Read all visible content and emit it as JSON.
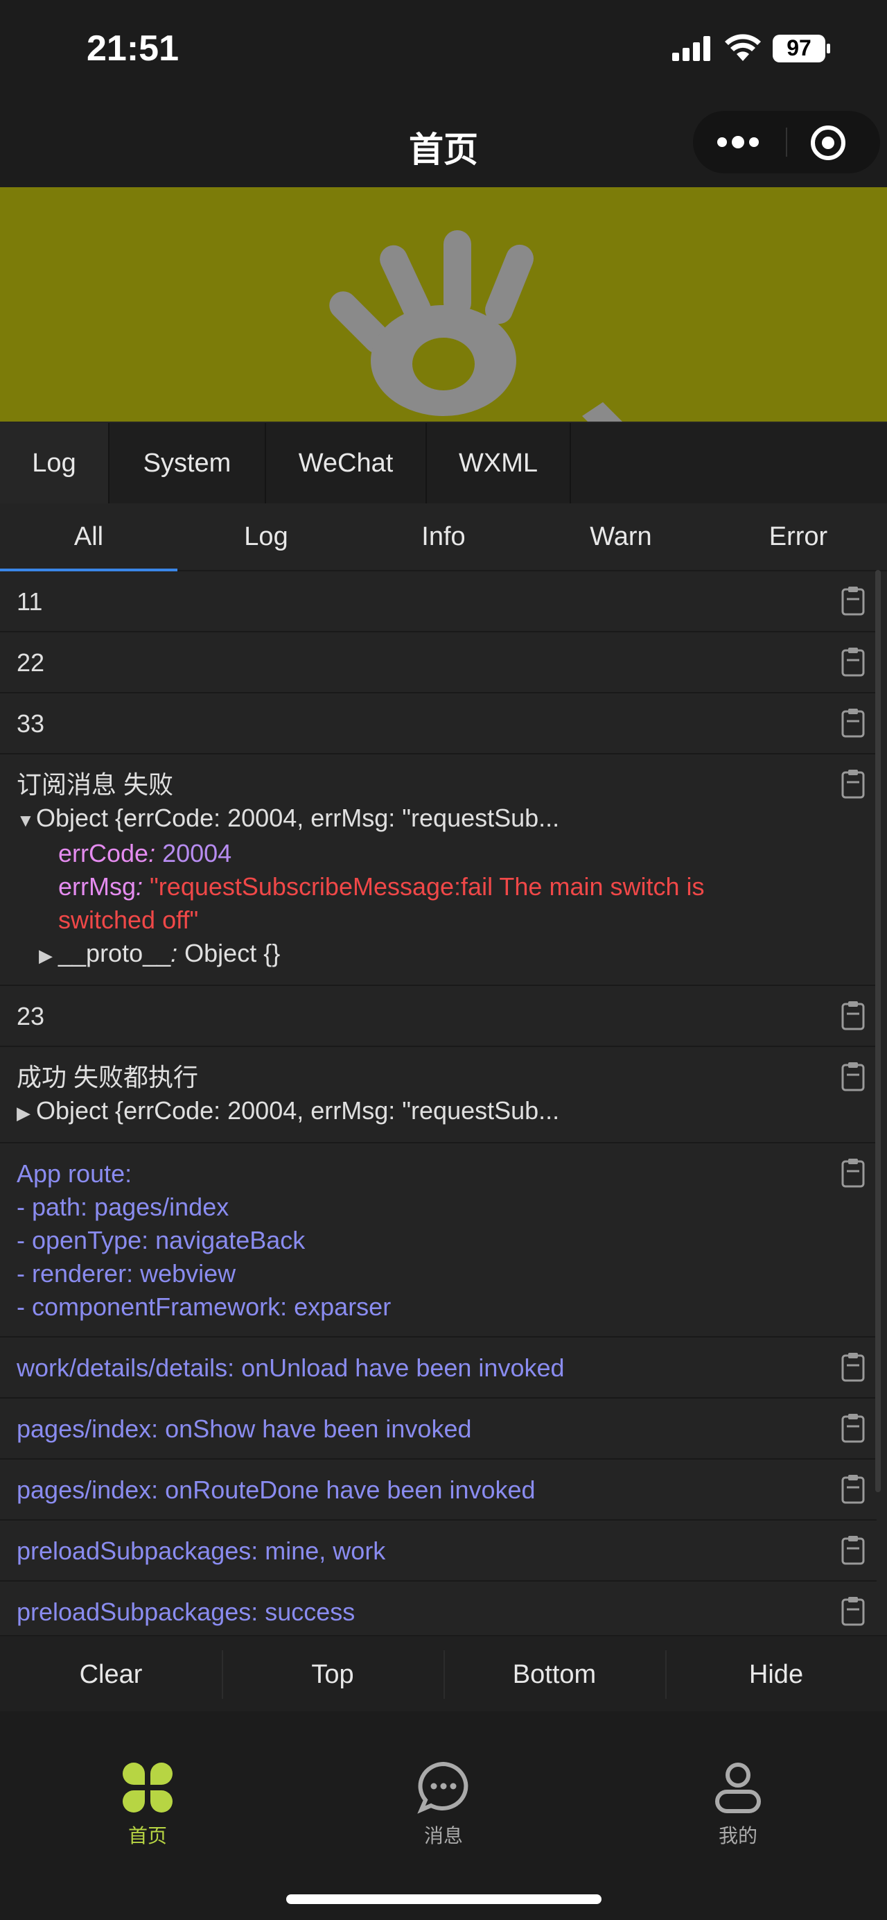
{
  "status_bar": {
    "time": "21:51",
    "battery": "97"
  },
  "nav": {
    "title": "首页"
  },
  "colors": {
    "banner": "#7c7c09",
    "accent_tab": "#3a86e8",
    "system_log": "#8a8cf0",
    "tabbar_active": "#b7d543"
  },
  "console": {
    "panel_tabs": [
      {
        "label": "Log",
        "active": true
      },
      {
        "label": "System",
        "active": false
      },
      {
        "label": "WeChat",
        "active": false
      },
      {
        "label": "WXML",
        "active": false
      }
    ],
    "filter_tabs": [
      {
        "label": "All",
        "active": true
      },
      {
        "label": "Log",
        "active": false
      },
      {
        "label": "Info",
        "active": false
      },
      {
        "label": "Warn",
        "active": false
      },
      {
        "label": "Error",
        "active": false
      }
    ],
    "entries": {
      "e1": "11",
      "e2": "22",
      "e3": "33",
      "e4": {
        "title": "订阅消息 失败",
        "summary": "Object {errCode: 20004, errMsg: \"requestSub...",
        "errCode_key": "errCode",
        "errCode_val": "20004",
        "errMsg_key": "errMsg",
        "errMsg_val_1": "\"requestSubscribeMessage:fail The main switch is",
        "errMsg_val_2": "switched off\"",
        "proto_key": "__proto__",
        "proto_val": "Object {}"
      },
      "e5": "23",
      "e6": {
        "title": "成功 失败都执行",
        "summary": "Object {errCode: 20004, errMsg: \"requestSub..."
      },
      "e7": {
        "line1": "App route:",
        "line2": "- path: pages/index",
        "line3": "- openType: navigateBack",
        "line4": "- renderer: webview",
        "line5": "- componentFramework: exparser"
      },
      "e8": "work/details/details: onUnload have been invoked",
      "e9": "pages/index: onShow have been invoked",
      "e10": "pages/index: onRouteDone have been invoked",
      "e11": "preloadSubpackages: mine, work",
      "e12": "preloadSubpackages: success"
    },
    "tools": [
      "Clear",
      "Top",
      "Bottom",
      "Hide"
    ]
  },
  "tabbar": [
    {
      "label": "首页",
      "icon": "grid-icon",
      "active": true
    },
    {
      "label": "消息",
      "icon": "chat-icon",
      "active": false
    },
    {
      "label": "我的",
      "icon": "user-icon",
      "active": false
    }
  ]
}
